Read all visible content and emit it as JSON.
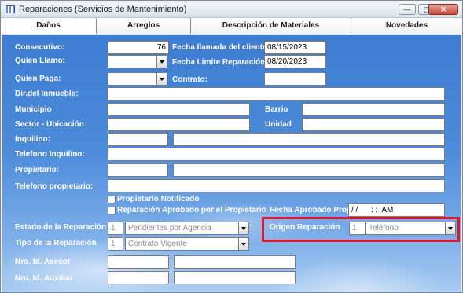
{
  "window": {
    "title": "Reparaciones (Servicios de Mantenimiento)",
    "controls": [
      "—",
      "▢",
      "✕"
    ]
  },
  "tabs": [
    {
      "label": "Daños",
      "active": true
    },
    {
      "label": "Arreglos",
      "active": false
    },
    {
      "label": "Descripción de Materiales",
      "active": false
    },
    {
      "label": "Novedades",
      "active": false
    }
  ],
  "form": {
    "consecutivo_label": "Consecutivo:",
    "consecutivo_value": "76",
    "quien_llamo_label": "Quien Llamo:",
    "quien_paga_label": "Quien Paga:",
    "fecha_llamada_label": "Fecha llamada del cliente:",
    "fecha_llamada_value": "08/15/2023",
    "fecha_limite_label": "Fecha Limite Reparación:",
    "fecha_limite_value": "08/20/2023",
    "contrato_label": "Contrato:",
    "dir_inmueble_label": "Dir.del Inmueble:",
    "municipio_label": "Municipio",
    "barrio_label": "Barrio",
    "sector_label": "Sector - Ubicación",
    "unidad_label": "Unidad",
    "inquilino_label": "Inquilino:",
    "telefono_inquilino_label": "Telefono Inquilino:",
    "propietario_label": "Propietario:",
    "telefono_propietario_label": "Telefono propietario:",
    "propietario_notificado_label": "Propietario Notificado",
    "reparacion_aprobado_label": "Reparación Aprobado por el Propietario",
    "fecha_aprobado_label": "Fecha Aprobado Prop:",
    "fecha_aprobado_value": "/ /      : :  AM",
    "estado_label": "Estado de la Reparación",
    "estado_code": "1",
    "estado_value": "Pendientes por Agencia",
    "tipo_label": "Tipo de la Reparación",
    "tipo_code": "1",
    "tipo_value": "Contrato Vigente",
    "origen_label": "Origen Reparación",
    "origen_code": "1",
    "origen_value": "Teléfono",
    "asesor_label": "Nro. Id. Asesor",
    "auxiliar_label": "Nro. Id. Auxiliar"
  },
  "colors": {
    "highlight": "#e3172b",
    "label_text": "#ffffff",
    "background_top": "#3d7cd1"
  }
}
